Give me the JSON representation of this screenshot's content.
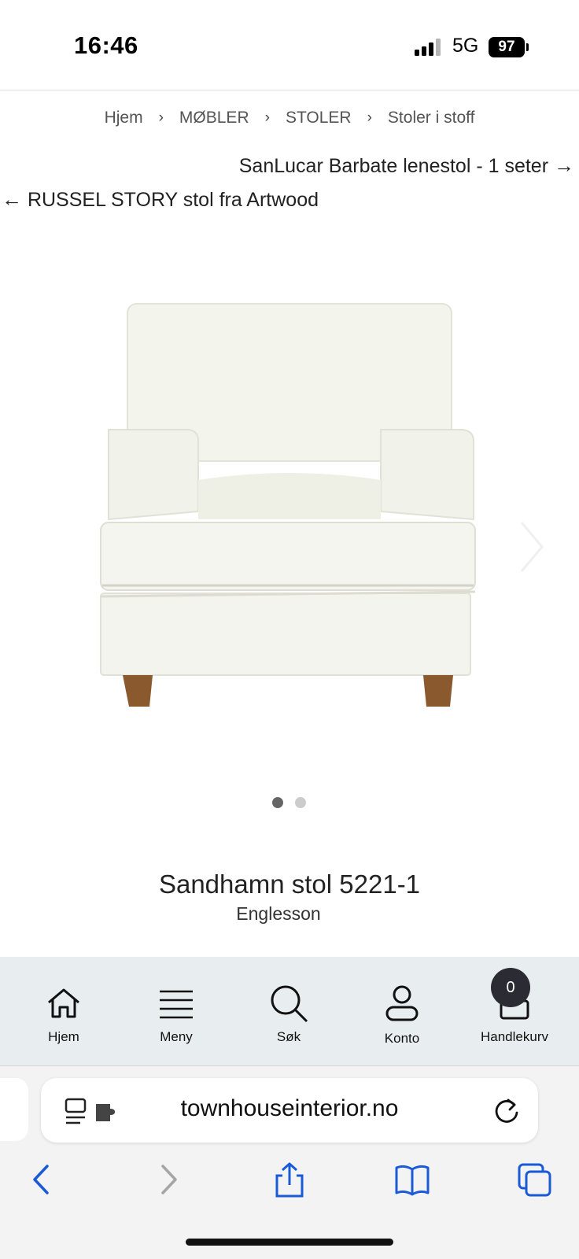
{
  "status_bar": {
    "time": "16:46",
    "network": "5G",
    "battery": "97"
  },
  "breadcrumb": {
    "items": [
      "Hjem",
      "MØBLER",
      "STOLER",
      "Stoler i stoff"
    ],
    "separator": "›"
  },
  "product_nav": {
    "next_label": "SanLucar Barbate lenestol - 1 seter",
    "next_arrow": "→",
    "prev_label": "RUSSEL STORY stol fra Artwood",
    "prev_arrow": "←"
  },
  "product": {
    "title": "Sandhamn stol 5221-1",
    "brand": "Englesson",
    "image_icon": "armchair-photo",
    "gallery_count": 2,
    "gallery_active_index": 0
  },
  "bottom_nav": {
    "items": [
      {
        "label": "Hjem",
        "icon": "home-icon"
      },
      {
        "label": "Meny",
        "icon": "menu-icon"
      },
      {
        "label": "Søk",
        "icon": "search-icon"
      },
      {
        "label": "Konto",
        "icon": "user-icon"
      },
      {
        "label": "Handlekurv",
        "icon": "cart-icon"
      }
    ],
    "cart_count": "0"
  },
  "browser": {
    "url": "townhouseinterior.no"
  },
  "colors": {
    "nav_background": "#e8eeef",
    "badge": "#2b2b34",
    "safari_accent": "#1a5ad8"
  }
}
